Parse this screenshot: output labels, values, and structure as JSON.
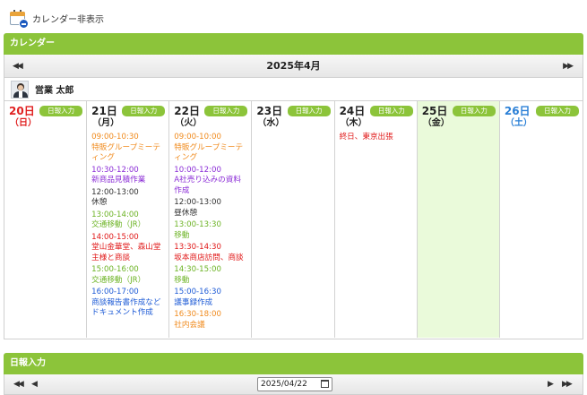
{
  "toggle": {
    "label": "カレンダー非表示"
  },
  "calendar_panel": {
    "title": "カレンダー"
  },
  "month": {
    "label": "2025年4月",
    "prev_glyph": "◀◀",
    "next_glyph": "▶▶"
  },
  "user": {
    "name": "営業 太郎"
  },
  "nippo_button_label": "日報入力",
  "days": [
    {
      "num": "20日",
      "wk": "（日）",
      "events": []
    },
    {
      "num": "21日",
      "wk": "（月）",
      "events": [
        {
          "time": "09:00-10:30",
          "title": "特販グループミーティング",
          "color": "#f08a1c"
        },
        {
          "time": "10:30-12:00",
          "title": "新商品見積作業",
          "color": "#8a2bd6"
        },
        {
          "time": "12:00-13:00",
          "title": "休憩",
          "color": "#333333"
        },
        {
          "time": "13:00-14:00",
          "title": "交通移動（JR）",
          "color": "#6cb324"
        },
        {
          "time": "14:00-15:00",
          "title": "堂山金華堂、森山堂主様と商談",
          "color": "#e01818"
        },
        {
          "time": "15:00-16:00",
          "title": "交通移動（JR）",
          "color": "#6cb324"
        },
        {
          "time": "16:00-17:00",
          "title": "商談報告書作成などドキュメント作成",
          "color": "#1e5bd6"
        }
      ]
    },
    {
      "num": "22日",
      "wk": "（火）",
      "events": [
        {
          "time": "09:00-10:00",
          "title": "特販グループミーティング",
          "color": "#f08a1c"
        },
        {
          "time": "10:00-12:00",
          "title": "A社売り込みの資料作成",
          "color": "#8a2bd6"
        },
        {
          "time": "12:00-13:00",
          "title": "昼休憩",
          "color": "#333333"
        },
        {
          "time": "13:00-13:30",
          "title": "移動",
          "color": "#6cb324"
        },
        {
          "time": "13:30-14:30",
          "title": "坂本商店訪問、商談",
          "color": "#e01818"
        },
        {
          "time": "14:30-15:00",
          "title": "移動",
          "color": "#6cb324"
        },
        {
          "time": "15:00-16:30",
          "title": "議事録作成",
          "color": "#1e5bd6"
        },
        {
          "time": "16:30-18:00",
          "title": "社内会議",
          "color": "#f08a1c"
        }
      ]
    },
    {
      "num": "23日",
      "wk": "（水）",
      "events": []
    },
    {
      "num": "24日",
      "wk": "（木）",
      "events": [
        {
          "time": "",
          "title": "終日、東京出張",
          "color": "#e01818"
        }
      ]
    },
    {
      "num": "25日",
      "wk": "（金）",
      "events": []
    },
    {
      "num": "26日",
      "wk": "（土）",
      "events": []
    }
  ],
  "nippo_panel": {
    "title": "日報入力"
  },
  "nippo_nav": {
    "prev_prev": "◀◀",
    "prev": "◀",
    "next": "▶",
    "next_next": "▶▶"
  },
  "date_input": {
    "value": "2025/04/22"
  }
}
